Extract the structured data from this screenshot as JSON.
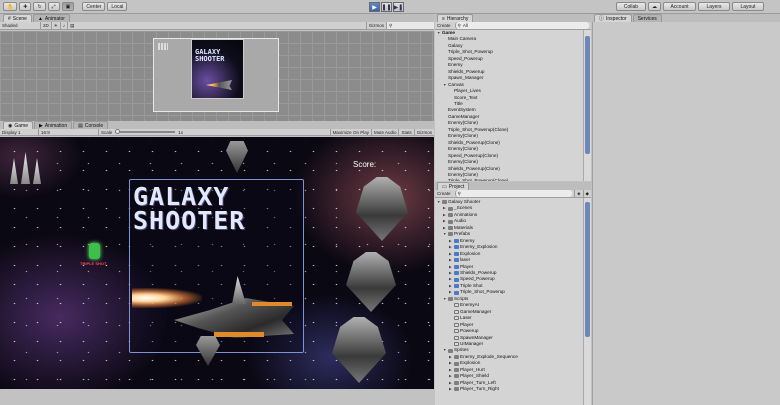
{
  "toolbar": {
    "pivot": "Center",
    "space": "Local",
    "collab": "Collab",
    "account": "Account",
    "layers": "Layers",
    "layout": "Layout"
  },
  "scene": {
    "tabs": [
      "Scene",
      "Animator"
    ],
    "shading": "Shaded",
    "mode2d": "2D",
    "gizmos": "Gizmos",
    "title_line1": "GALAXY",
    "title_line2": "SHOOTER"
  },
  "game": {
    "tabs": [
      "Game",
      "Animation",
      "Console"
    ],
    "display": "Display 1",
    "aspect": "16:9",
    "scale_label": "Scale",
    "scale_value": "1x",
    "toggles": [
      "Maximize On Play",
      "Mute Audio",
      "Stats",
      "Gizmos"
    ],
    "score": "Score:",
    "title_line1": "GALAXY",
    "title_line2": "SHOOTER",
    "powerup_label": "TRIPLE SHOT"
  },
  "hierarchy": {
    "tab": "Hierarchy",
    "create": "Create",
    "search": "All",
    "items": [
      {
        "label": "Game",
        "depth": 0,
        "open": true,
        "bold": true
      },
      {
        "label": "Main Camera",
        "depth": 1
      },
      {
        "label": "Galaxy",
        "depth": 1
      },
      {
        "label": "Triple_Shot_Powerup",
        "depth": 1
      },
      {
        "label": "Speed_Powerup",
        "depth": 1
      },
      {
        "label": "Enemy",
        "depth": 1
      },
      {
        "label": "Shields_Powerup",
        "depth": 1
      },
      {
        "label": "Spawn_Manager",
        "depth": 1
      },
      {
        "label": "Canvas",
        "depth": 1,
        "open": true
      },
      {
        "label": "Player_Lives",
        "depth": 2
      },
      {
        "label": "Score_Text",
        "depth": 2
      },
      {
        "label": "Title",
        "depth": 2
      },
      {
        "label": "EventSystem",
        "depth": 1
      },
      {
        "label": "GameManager",
        "depth": 1
      },
      {
        "label": "Enemy(Clone)",
        "depth": 1
      },
      {
        "label": "Triple_Shot_Powerup(Clone)",
        "depth": 1
      },
      {
        "label": "Enemy(Clone)",
        "depth": 1
      },
      {
        "label": "Shields_Powerup(Clone)",
        "depth": 1
      },
      {
        "label": "Enemy(Clone)",
        "depth": 1
      },
      {
        "label": "Speed_Powerup(Clone)",
        "depth": 1
      },
      {
        "label": "Enemy(Clone)",
        "depth": 1
      },
      {
        "label": "Shields_Powerup(Clone)",
        "depth": 1
      },
      {
        "label": "Enemy(Clone)",
        "depth": 1
      },
      {
        "label": "Triple_Shot_Powerup(Clone)",
        "depth": 1
      }
    ]
  },
  "project": {
    "tab": "Project",
    "create": "Create",
    "items": [
      {
        "label": "Galaxy Shooter",
        "depth": 0,
        "type": "folder",
        "open": true
      },
      {
        "label": "_Scenes",
        "depth": 1,
        "type": "folder"
      },
      {
        "label": "Animations",
        "depth": 1,
        "type": "folder"
      },
      {
        "label": "Audio",
        "depth": 1,
        "type": "folder"
      },
      {
        "label": "Materials",
        "depth": 1,
        "type": "folder"
      },
      {
        "label": "Prefabs",
        "depth": 1,
        "type": "folder",
        "open": true
      },
      {
        "label": "Enemy",
        "depth": 2,
        "type": "prefab"
      },
      {
        "label": "Enemy_Explosion",
        "depth": 2,
        "type": "prefab"
      },
      {
        "label": "Explosion",
        "depth": 2,
        "type": "prefab"
      },
      {
        "label": "laser",
        "depth": 2,
        "type": "prefab"
      },
      {
        "label": "Player",
        "depth": 2,
        "type": "prefab"
      },
      {
        "label": "Shields_Powerup",
        "depth": 2,
        "type": "prefab"
      },
      {
        "label": "Speed_Powerup",
        "depth": 2,
        "type": "prefab"
      },
      {
        "label": "Triple Shot",
        "depth": 2,
        "type": "prefab"
      },
      {
        "label": "Triple_Shot_Powerup",
        "depth": 2,
        "type": "prefab"
      },
      {
        "label": "Scripts",
        "depth": 1,
        "type": "folder",
        "open": true
      },
      {
        "label": "EnemyAI",
        "depth": 2,
        "type": "script"
      },
      {
        "label": "GameManager",
        "depth": 2,
        "type": "script"
      },
      {
        "label": "Laser",
        "depth": 2,
        "type": "script"
      },
      {
        "label": "Player",
        "depth": 2,
        "type": "script"
      },
      {
        "label": "Powerup",
        "depth": 2,
        "type": "script"
      },
      {
        "label": "SpawnManager",
        "depth": 2,
        "type": "script"
      },
      {
        "label": "UIManager",
        "depth": 2,
        "type": "script"
      },
      {
        "label": "Sprites",
        "depth": 1,
        "type": "folder",
        "open": true
      },
      {
        "label": "Enemy_Explode_Sequence",
        "depth": 2,
        "type": "folder"
      },
      {
        "label": "Explosion",
        "depth": 2,
        "type": "folder"
      },
      {
        "label": "Player_Hurt",
        "depth": 2,
        "type": "folder"
      },
      {
        "label": "Player_Shield",
        "depth": 2,
        "type": "folder"
      },
      {
        "label": "Player_Turn_Left",
        "depth": 2,
        "type": "folder"
      },
      {
        "label": "Player_Turn_Right",
        "depth": 2,
        "type": "folder"
      }
    ]
  },
  "inspector": {
    "tabs": [
      "Inspector",
      "Services"
    ]
  },
  "colors": {
    "accent": "#3a64ad",
    "title_cyan": "#dfe9ff",
    "frame": "#7e93d6"
  }
}
